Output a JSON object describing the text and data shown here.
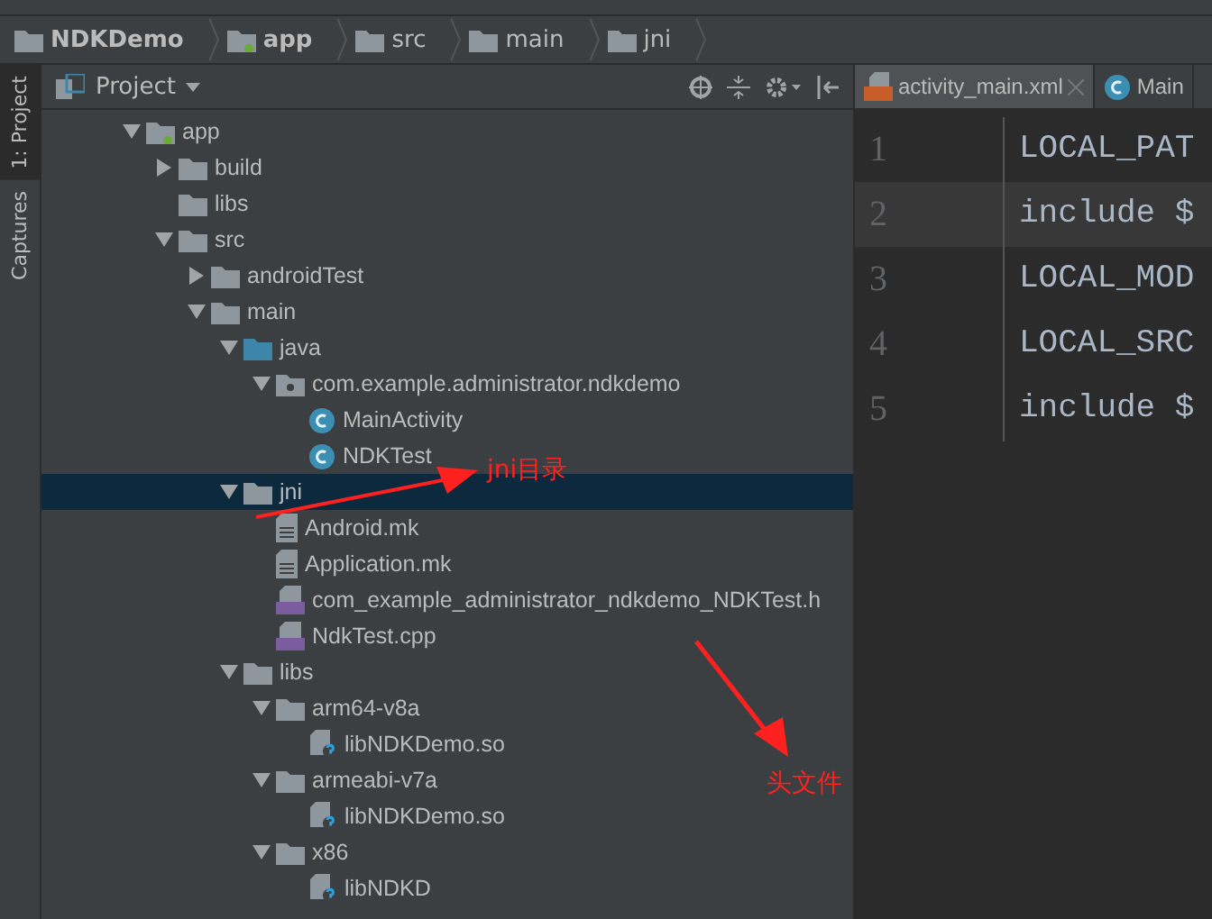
{
  "breadcrumbs": [
    {
      "label": "NDKDemo",
      "kind": "project"
    },
    {
      "label": "app",
      "kind": "module"
    },
    {
      "label": "src",
      "kind": "folder"
    },
    {
      "label": "main",
      "kind": "folder"
    },
    {
      "label": "jni",
      "kind": "folder"
    }
  ],
  "side_tabs": [
    {
      "label": "1: Project",
      "selected": true
    },
    {
      "label": "Captures",
      "selected": false
    }
  ],
  "project_panel": {
    "title": "Project"
  },
  "tree": [
    {
      "label": "app",
      "kind": "module",
      "expanded": true,
      "selected": false,
      "children": [
        {
          "label": "build",
          "kind": "folder",
          "expanded": false,
          "selected": false
        },
        {
          "label": "libs",
          "kind": "folder",
          "selected": false
        },
        {
          "label": "src",
          "kind": "folder",
          "expanded": true,
          "selected": false,
          "children": [
            {
              "label": "androidTest",
              "kind": "folder",
              "expanded": false,
              "selected": false
            },
            {
              "label": "main",
              "kind": "folder",
              "expanded": true,
              "selected": false,
              "children": [
                {
                  "label": "java",
                  "kind": "source",
                  "expanded": true,
                  "selected": false,
                  "children": [
                    {
                      "label": "com.example.administrator.ndkdemo",
                      "kind": "package",
                      "expanded": true,
                      "selected": false,
                      "children": [
                        {
                          "label": "MainActivity",
                          "kind": "class",
                          "selected": false
                        },
                        {
                          "label": "NDKTest",
                          "kind": "class",
                          "selected": false
                        }
                      ]
                    }
                  ]
                },
                {
                  "label": "jni",
                  "kind": "folder",
                  "expanded": true,
                  "selected": true,
                  "children": [
                    {
                      "label": "Android.mk",
                      "kind": "file",
                      "selected": false
                    },
                    {
                      "label": "Application.mk",
                      "kind": "file",
                      "selected": false
                    },
                    {
                      "label": "com_example_administrator_ndkdemo_NDKTest.h",
                      "kind": "cpp",
                      "selected": false
                    },
                    {
                      "label": "NdkTest.cpp",
                      "kind": "cpp",
                      "selected": false
                    }
                  ]
                },
                {
                  "label": "libs",
                  "kind": "folder",
                  "expanded": true,
                  "selected": false,
                  "children": [
                    {
                      "label": "arm64-v8a",
                      "kind": "folder",
                      "expanded": true,
                      "selected": false,
                      "children": [
                        {
                          "label": "libNDKDemo.so",
                          "kind": "binary",
                          "selected": false
                        }
                      ]
                    },
                    {
                      "label": "armeabi-v7a",
                      "kind": "folder",
                      "expanded": true,
                      "selected": false,
                      "children": [
                        {
                          "label": "libNDKDemo.so",
                          "kind": "binary",
                          "selected": false
                        }
                      ]
                    },
                    {
                      "label": "x86",
                      "kind": "folder",
                      "expanded": true,
                      "selected": false,
                      "children": [
                        {
                          "label": "libNDKD",
                          "kind": "binary",
                          "selected": false
                        }
                      ]
                    }
                  ]
                }
              ]
            }
          ]
        }
      ]
    }
  ],
  "editor_tabs": [
    {
      "label": "activity_main.xml",
      "kind": "xml",
      "selected": true
    },
    {
      "label": "Main",
      "kind": "class",
      "selected": false
    }
  ],
  "code_lines": [
    {
      "number": "1",
      "text": "LOCAL_PAT",
      "current": false
    },
    {
      "number": "2",
      "text": "include $",
      "current": true
    },
    {
      "number": "3",
      "text": "LOCAL_MOD",
      "current": false
    },
    {
      "number": "4",
      "text": "LOCAL_SRC",
      "current": false
    },
    {
      "number": "5",
      "text": "include $",
      "current": false
    }
  ],
  "annotations": [
    {
      "label": "jni目录"
    },
    {
      "label": "头文件"
    }
  ]
}
